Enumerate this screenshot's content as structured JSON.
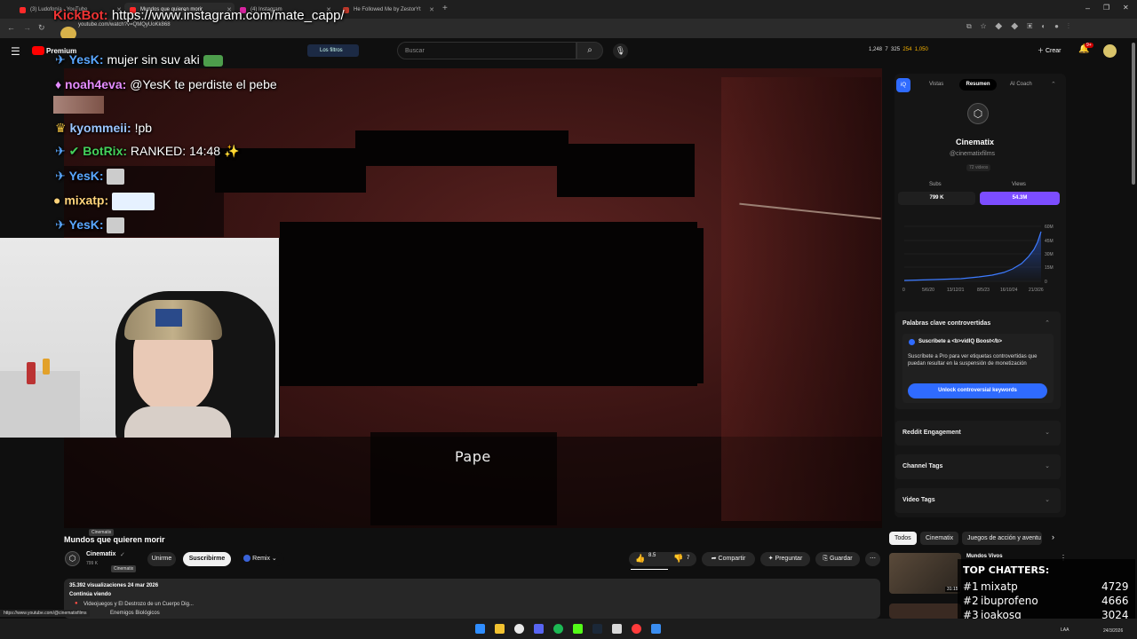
{
  "browser": {
    "tabs": [
      {
        "label": "(3) Ludofonía - YouTube",
        "active": false
      },
      {
        "label": "Mundos que quieren morir",
        "active": true
      },
      {
        "label": "(4) Instagram",
        "active": false
      },
      {
        "label": "He Followed Me by ZestorYt",
        "active": false
      }
    ],
    "url": "youtube.com/watch?v=QMQyUoKk868"
  },
  "kickbot_banner": {
    "name": "KickBot:",
    "text": "https://www.instagram.com/mate_capp/"
  },
  "masthead": {
    "logo_label": "Premium",
    "filter_label": "Los filtros",
    "search_placeholder": "Buscar",
    "stats": [
      "1,248",
      "7",
      "325",
      "254",
      "1,050"
    ],
    "create_label": "Crear",
    "notif_count": "9+"
  },
  "chat": [
    {
      "user": "YesK:",
      "msg": "mujer sin suv aki",
      "color": "#5aa7ff"
    },
    {
      "user": "noah4eva:",
      "msg": "@YesK te perdiste el pebe",
      "color": "#e58cff"
    },
    {
      "user": "kyommeii:",
      "msg": "!pb",
      "color": "#9bc5ff"
    },
    {
      "user": "BotRix:",
      "msg": "RANKED: 14:48",
      "color": "#44d15a"
    },
    {
      "user": "YesK:",
      "msg": "",
      "color": "#5aa7ff"
    },
    {
      "user": "mixatp:",
      "msg": "",
      "color": "#ffd37a"
    },
    {
      "user": "YesK:",
      "msg": "",
      "color": "#5aa7ff"
    }
  ],
  "video": {
    "subtitle": "Pape",
    "title": "Mundos que quieren morir",
    "tooltip": "Cinematix"
  },
  "channel": {
    "name": "Cinematix",
    "subs": "799 K",
    "tooltip": "Cinematix",
    "join_label": "Unirme",
    "subscribe_label": "Suscribirme",
    "remix_label": "Remix"
  },
  "actions": {
    "likes": "8.5",
    "dislikes": "7",
    "share": "Compartir",
    "ask": "Preguntar",
    "save": "Guardar"
  },
  "description": {
    "views_date": "35.392 visualizaciones  24 mar 2026",
    "continue": "Continúa viendo",
    "line1": "Videojuegos y El Destrozo de un Cuerpo Dig...",
    "line2": "Enemigos Biológicos"
  },
  "vidiq": {
    "tabs": [
      "Vistas",
      "Resumen",
      "AI Coach"
    ],
    "active_tab": "Resumen",
    "channel_name": "Cinematix",
    "handle": "@cinematixfilms",
    "videos": "72 videos",
    "subs_label": "Subs",
    "views_label": "Views",
    "subs_value": "799 K",
    "views_value": "54.3M",
    "chart_y_ticks": [
      "60M",
      "45M",
      "30M",
      "15M",
      "0"
    ],
    "chart_x_ticks": [
      "0",
      "5/6/20",
      "13/12/21",
      "8/5/23",
      "16/10/24",
      "21/3/26"
    ],
    "keywords_title": "Palabras clave controvertidas",
    "promo_title": "Suscríbete a <b>vidIQ Boost</b>",
    "promo_text": "Suscríbete a Pro para ver etiquetas controvertidas que puedan resultar en la suspensión de monetización",
    "unlock_label": "Unlock controversial keywords",
    "sections": [
      "Reddit Engagement",
      "Channel Tags",
      "Video Tags"
    ]
  },
  "chips": [
    "Todos",
    "Cinematix",
    "Juegos de acción y aventu"
  ],
  "recommendations": [
    {
      "title": "Mundos Vivos",
      "duration": "31:15"
    }
  ],
  "top_chatters": {
    "title": "TOP CHATTERS:",
    "entries": [
      {
        "rank": "#1",
        "name": "mixatp",
        "count": "4729"
      },
      {
        "rank": "#2",
        "name": "ibuprofeno",
        "count": "4666"
      },
      {
        "rank": "#3",
        "name": "joakosq",
        "count": "3024"
      }
    ]
  },
  "status_url": "https://www.youtube.com/@cinematixfilms",
  "taskbar": {
    "lang": "LAA",
    "date": "24/3/2026"
  },
  "colors": {
    "accent_purple": "#7c4dff",
    "unlock_blue": "#2f6bff",
    "yt_red": "#ff0000"
  }
}
